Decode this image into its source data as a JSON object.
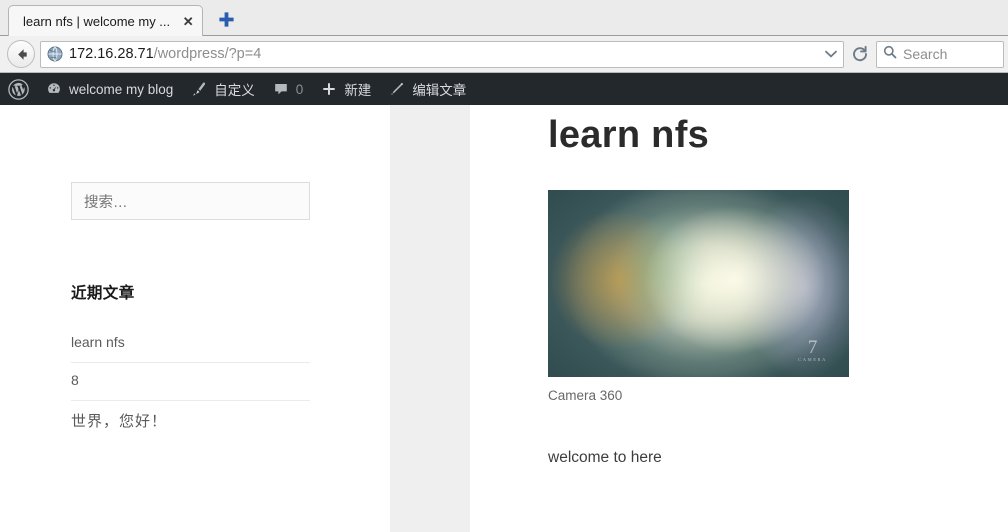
{
  "browser": {
    "tab": {
      "title": "learn nfs | welcome my ...",
      "close_label": "✕",
      "favicon_name": "globe-icon"
    },
    "newtab_label": "+",
    "url": {
      "host": "172.16.28.71",
      "path": "/wordpress/?p=4",
      "full": "172.16.28.71/wordpress/?p=4"
    },
    "search": {
      "placeholder": "Search"
    },
    "back_label": "←",
    "reload_label": "⟳"
  },
  "adminbar": {
    "logo_name": "wordpress-logo-icon",
    "items": [
      {
        "label": "welcome my blog",
        "icon": "dashboard-icon"
      },
      {
        "label": "自定义",
        "icon": "brush-icon"
      },
      {
        "label": "0",
        "icon": "comment-icon"
      },
      {
        "label": "新建",
        "icon": "plus-icon"
      },
      {
        "label": "编辑文章",
        "icon": "pencil-icon"
      }
    ],
    "bg_color": "#23282d"
  },
  "sidebar": {
    "search": {
      "placeholder": "搜索…"
    },
    "recent_posts": {
      "title": "近期文章",
      "items": [
        {
          "label": "learn nfs",
          "cjk": false
        },
        {
          "label": "8",
          "cjk": false
        },
        {
          "label": "世界，您好！",
          "cjk": true
        }
      ]
    }
  },
  "content": {
    "post_title": "learn nfs",
    "figure_caption": "Camera  360",
    "photo_watermark": "7",
    "photo_watermark_sub": "CAMERA",
    "body_text": "welcome to here"
  },
  "colors": {
    "admin_bar": "#23282d",
    "stripe": "#efefef",
    "tabstrip": "#ebebeb",
    "accent_blue": "#2a5db0"
  }
}
